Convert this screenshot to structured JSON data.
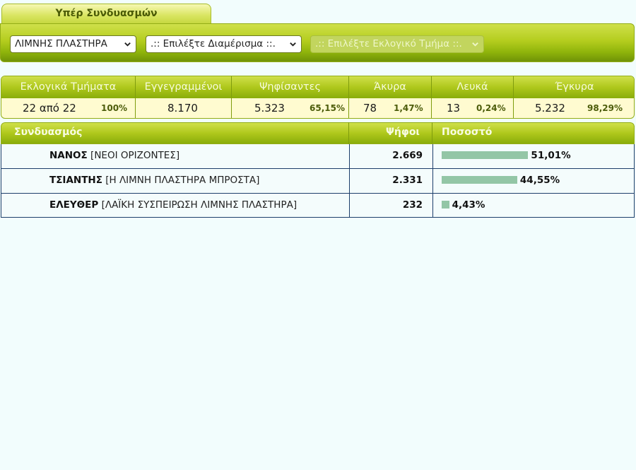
{
  "tab": {
    "label": "Υπέρ Συνδυασμών"
  },
  "selectors": {
    "municipality": ".: ΛΙΜΝΗΣ ΠΛΑΣΤΗΡΑ",
    "municipality_visible": "ΛΙΜΝΗΣ ΠΛΑΣΤΗΡΑ",
    "district": ".:: Επιλέξτε Διαμέρισμα ::.",
    "polling_station": ".:: Επιλέξτε Εκλογικό Τμήμα ::."
  },
  "stats": {
    "headers": [
      "Εκλογικά Τμήματα",
      "Εγγεγραμμένοι",
      "Ψηφίσαντες",
      "Άκυρα",
      "Λευκά",
      "Έγκυρα"
    ],
    "stations": "22 από 22",
    "stations_pct": "100%",
    "registered": "8.170",
    "voted": "5.323",
    "voted_pct": "65,15%",
    "invalid": "78",
    "invalid_pct": "1,47%",
    "blank": "13",
    "blank_pct": "0,24%",
    "valid": "5.232",
    "valid_pct": "98,29%"
  },
  "results": {
    "headers": {
      "party": "Συνδυασμός",
      "votes": "Ψήφοι",
      "percent": "Ποσοστό"
    },
    "rows": [
      {
        "leader": "ΝΑΝΟΣ",
        "party": "[ΝΕΟΙ ΟΡΙΖΟΝΤΕΣ]",
        "votes": "2.669",
        "percent": "51,01%",
        "share": 51.01
      },
      {
        "leader": "ΤΣΙΑΝΤΗΣ",
        "party": "[Η ΛΙΜΝΗ ΠΛΑΣΤΗΡΑ ΜΠΡΟΣΤΑ]",
        "votes": "2.331",
        "percent": "44,55%",
        "share": 44.55
      },
      {
        "leader": "ΕΛΕΥΘΕΡ",
        "party": "[ΛΑΪΚΗ ΣΥΣΠΕΙΡΩΣΗ ΛΙΜΝΗΣ ΠΛΑΣΤΗΡΑ]",
        "votes": "232",
        "percent": "4,43%",
        "share": 4.43
      }
    ]
  },
  "colors": {
    "bar": "#93c6a6",
    "header_green": "#afc81c",
    "grid": "#1d3e6a"
  }
}
